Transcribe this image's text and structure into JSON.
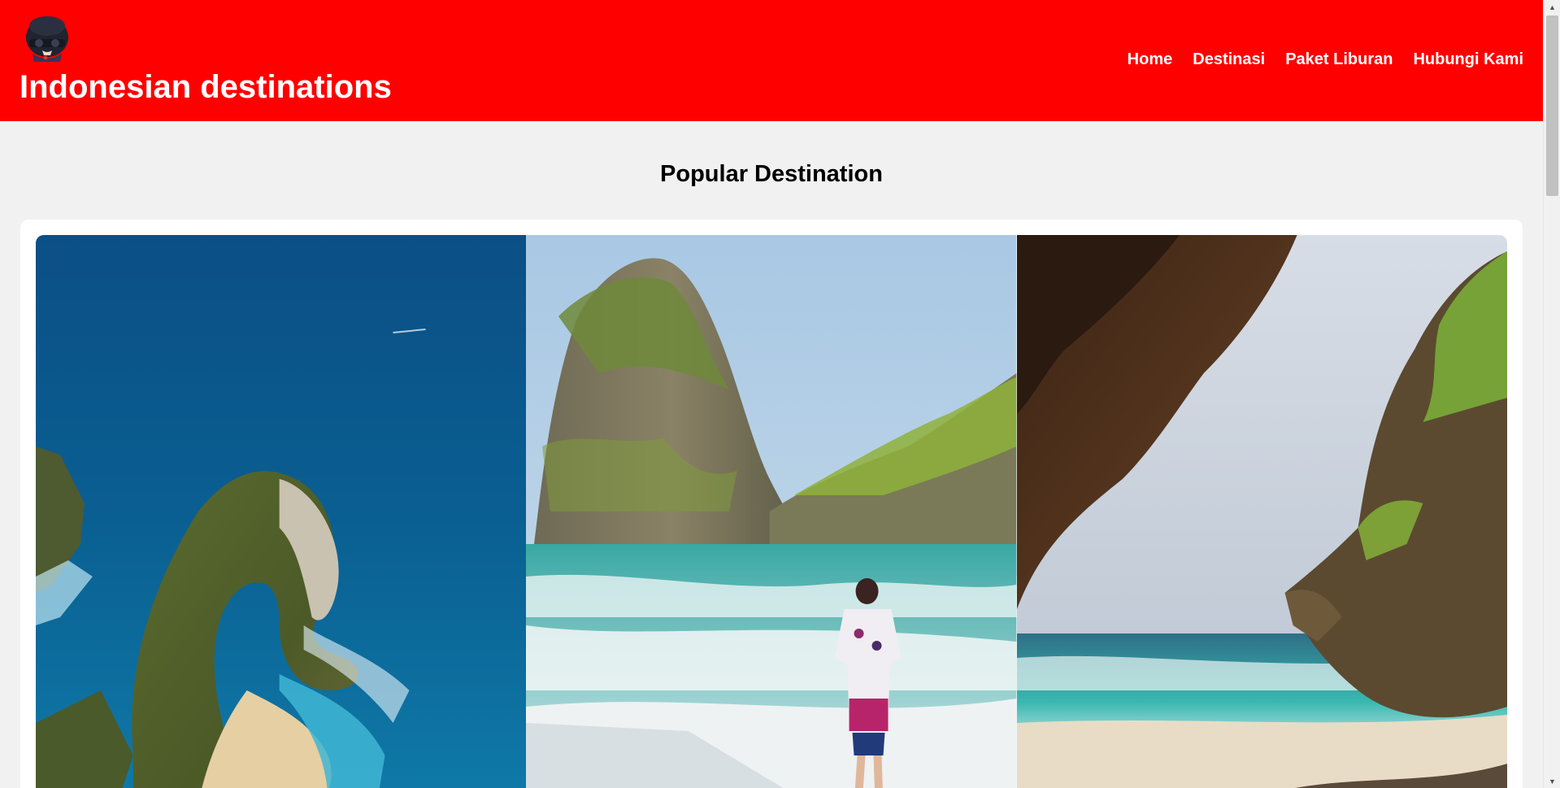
{
  "header": {
    "title": "Indonesian destinations",
    "logo_icon": "avatar-logo-icon",
    "nav": [
      {
        "label": "Home"
      },
      {
        "label": "Destinasi"
      },
      {
        "label": "Paket Liburan"
      },
      {
        "label": "Hubungi Kami"
      }
    ],
    "background_color": "#ff0000"
  },
  "main": {
    "section_title": "Popular Destination",
    "photos": [
      {
        "name": "kelingking-beach-photo"
      },
      {
        "name": "diamond-beach-photo"
      },
      {
        "name": "uluwatu-beach-cave-photo"
      }
    ]
  }
}
